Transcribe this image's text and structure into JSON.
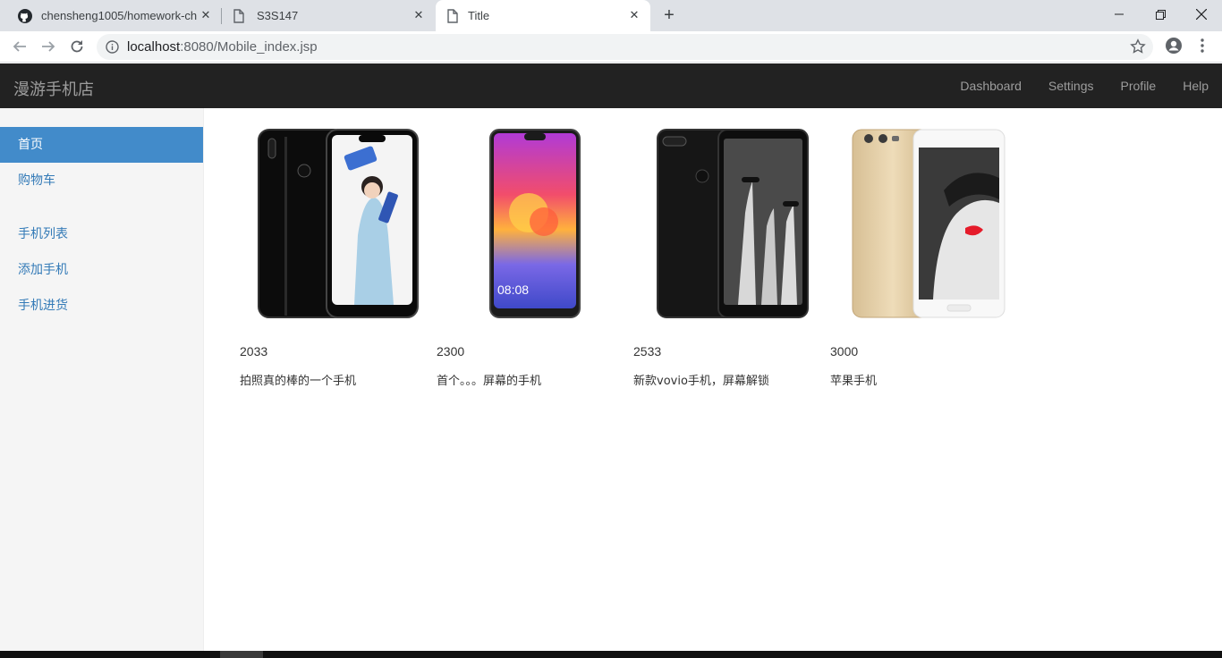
{
  "browser": {
    "tabs": [
      {
        "title": "chensheng1005/homework-ch",
        "icon": "github-icon"
      },
      {
        "title": "S3S147",
        "icon": "page-icon"
      },
      {
        "title": "Title",
        "icon": "page-icon",
        "active": true
      }
    ],
    "url_host": "localhost",
    "url_rest": ":8080/Mobile_index.jsp"
  },
  "navbar": {
    "brand": "漫游手机店",
    "links": [
      "Dashboard",
      "Settings",
      "Profile",
      "Help"
    ]
  },
  "sidebar": {
    "items": [
      {
        "label": "首页",
        "active": true
      },
      {
        "label": "购物车"
      },
      {
        "label": "手机列表"
      },
      {
        "label": "添加手机"
      },
      {
        "label": "手机进货"
      }
    ]
  },
  "products": [
    {
      "price": "2033",
      "description": "拍照真的棒的一个手机",
      "image": "black-dual-phone-woman-screen"
    },
    {
      "price": "2300",
      "description": "首个。。。屏幕的手机",
      "image": "purple-phone-colorful-screen"
    },
    {
      "price": "2533",
      "description": "新款vovio手机，屏幕解锁",
      "image": "black-dual-phone-giraffe-screen"
    },
    {
      "price": "3000",
      "description": "苹果手机",
      "image": "gold-dual-phone-mask-screen"
    }
  ],
  "colors": {
    "navbar": "#222222",
    "sidebar_active": "#428bca",
    "link": "#337ab7"
  }
}
